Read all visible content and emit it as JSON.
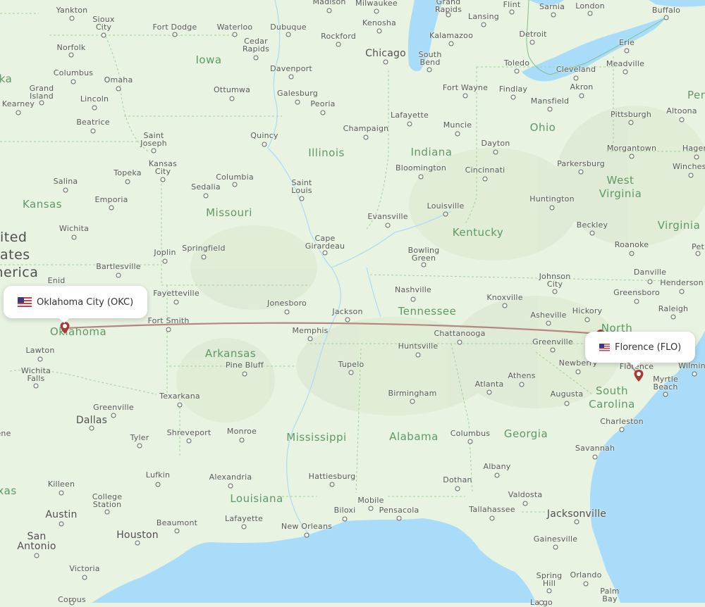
{
  "map": {
    "colors": {
      "land": "#e9f3e2",
      "water": "#a8dcf8",
      "route": "#b07a78",
      "marker": "#a83a3a",
      "state_label": "#5d9a63",
      "city_label": "#5a5a5a"
    },
    "country_label_lines": [
      "ited",
      "ates",
      "merica"
    ],
    "states": [
      {
        "name": "Iowa"
      },
      {
        "name": "Illinois"
      },
      {
        "name": "Indiana"
      },
      {
        "name": "Ohio"
      },
      {
        "name": "Pennsy"
      },
      {
        "name": "West Virginia"
      },
      {
        "name": "Virginia"
      },
      {
        "name": "Kansas"
      },
      {
        "name": "Missouri"
      },
      {
        "name": "Kentucky"
      },
      {
        "name": "Tennessee"
      },
      {
        "name": "North"
      },
      {
        "name": "Oklahoma"
      },
      {
        "name": "Arkansas"
      },
      {
        "name": "Mississippi"
      },
      {
        "name": "Alabama"
      },
      {
        "name": "Georgia"
      },
      {
        "name": "South Carolina"
      },
      {
        "name": "Louisiana"
      },
      {
        "name": "xas"
      },
      {
        "name": "ka"
      }
    ],
    "cities": [
      {
        "name": "Yankton"
      },
      {
        "name": "Sioux City"
      },
      {
        "name": "Fort Dodge"
      },
      {
        "name": "Waterloo"
      },
      {
        "name": "Dubuque"
      },
      {
        "name": "Madison"
      },
      {
        "name": "Milwaukee"
      },
      {
        "name": "Kenosha"
      },
      {
        "name": "Grand Rapids"
      },
      {
        "name": "Lansing"
      },
      {
        "name": "Flint"
      },
      {
        "name": "Sarnia"
      },
      {
        "name": "London"
      },
      {
        "name": "Buffalo"
      },
      {
        "name": "Norfolk"
      },
      {
        "name": "Cedar Rapids"
      },
      {
        "name": "Rockford"
      },
      {
        "name": "Chicago"
      },
      {
        "name": "Kalamazoo"
      },
      {
        "name": "Detroit"
      },
      {
        "name": "Erie"
      },
      {
        "name": "Columbus"
      },
      {
        "name": "Omaha"
      },
      {
        "name": "Davenport"
      },
      {
        "name": "South Bend"
      },
      {
        "name": "Toledo"
      },
      {
        "name": "Cleveland"
      },
      {
        "name": "Meadville"
      },
      {
        "name": "Grand Island"
      },
      {
        "name": "Kearney"
      },
      {
        "name": "Lincoln"
      },
      {
        "name": "Ottumwa"
      },
      {
        "name": "Galesburg"
      },
      {
        "name": "Peoria"
      },
      {
        "name": "Fort Wayne"
      },
      {
        "name": "Findlay"
      },
      {
        "name": "Akron"
      },
      {
        "name": "Mansfield"
      },
      {
        "name": "Pittsburgh"
      },
      {
        "name": "Altoona"
      },
      {
        "name": "Beatrice"
      },
      {
        "name": "Lafayette"
      },
      {
        "name": "Champaign"
      },
      {
        "name": "Muncie"
      },
      {
        "name": "Saint Joseph"
      },
      {
        "name": "Quincy"
      },
      {
        "name": "Dayton"
      },
      {
        "name": "Morgantown"
      },
      {
        "name": "Hagers"
      },
      {
        "name": "Kansas City"
      },
      {
        "name": "Topeka"
      },
      {
        "name": "Bloomington"
      },
      {
        "name": "Cincinnati"
      },
      {
        "name": "Parkersburg"
      },
      {
        "name": "Winchest"
      },
      {
        "name": "Salina"
      },
      {
        "name": "Columbia"
      },
      {
        "name": "Sedalia"
      },
      {
        "name": "Saint Louis"
      },
      {
        "name": "Emporia"
      },
      {
        "name": "Huntington"
      },
      {
        "name": "Louisville"
      },
      {
        "name": "Evansville"
      },
      {
        "name": "Wichita"
      },
      {
        "name": "Beckley"
      },
      {
        "name": "Cape Girardeau"
      },
      {
        "name": "Roanoke"
      },
      {
        "name": "Pet"
      },
      {
        "name": "Bowling Green"
      },
      {
        "name": "Joplin"
      },
      {
        "name": "Springfield"
      },
      {
        "name": "Bartlesville"
      },
      {
        "name": "Danville"
      },
      {
        "name": "Johnson City"
      },
      {
        "name": "Henderson"
      },
      {
        "name": "Enid"
      },
      {
        "name": "Nashville"
      },
      {
        "name": "Fayetteville"
      },
      {
        "name": "Greensboro"
      },
      {
        "name": "Knoxville"
      },
      {
        "name": "Jonesboro"
      },
      {
        "name": "Raleigh"
      },
      {
        "name": "Hickory"
      },
      {
        "name": "Asheville"
      },
      {
        "name": "Jackson"
      },
      {
        "name": "Fort Smith"
      },
      {
        "name": "Memphis"
      },
      {
        "name": "Chattanooga"
      },
      {
        "name": "Greenville"
      },
      {
        "name": "Huntsville"
      },
      {
        "name": "Lawton"
      },
      {
        "name": "Newberry"
      },
      {
        "name": "Florence"
      },
      {
        "name": "Wilming"
      },
      {
        "name": "Myrtle Beach"
      },
      {
        "name": "Pine Bluff"
      },
      {
        "name": "Wichita Falls"
      },
      {
        "name": "Tupelo"
      },
      {
        "name": "Athens"
      },
      {
        "name": "Atlanta"
      },
      {
        "name": "Birmingham"
      },
      {
        "name": "Texarkana"
      },
      {
        "name": "Augusta"
      },
      {
        "name": "Greenville"
      },
      {
        "name": "Dallas"
      },
      {
        "name": "Charleston"
      },
      {
        "name": "Shreveport"
      },
      {
        "name": "Monroe"
      },
      {
        "name": "Tyler"
      },
      {
        "name": "Columbus"
      },
      {
        "name": "Savannah"
      },
      {
        "name": "ene"
      },
      {
        "name": "Albany"
      },
      {
        "name": "Lufkin"
      },
      {
        "name": "Alexandria"
      },
      {
        "name": "Hattiesburg"
      },
      {
        "name": "Killeen"
      },
      {
        "name": "Dothan"
      },
      {
        "name": "College Station"
      },
      {
        "name": "Valdosta"
      },
      {
        "name": "Mobile"
      },
      {
        "name": "Tallahassee"
      },
      {
        "name": "Jacksonville"
      },
      {
        "name": "Austin"
      },
      {
        "name": "Lafayette"
      },
      {
        "name": "Biloxi"
      },
      {
        "name": "Pensacola"
      },
      {
        "name": "Beaumont"
      },
      {
        "name": "New Orleans"
      },
      {
        "name": "Houston"
      },
      {
        "name": "Gainesville"
      },
      {
        "name": "San Antonio"
      },
      {
        "name": "Victoria"
      },
      {
        "name": "Spring Hill"
      },
      {
        "name": "Orlando"
      },
      {
        "name": "Palm Bay"
      },
      {
        "name": "Corpus"
      },
      {
        "name": "Largo"
      }
    ],
    "origin": {
      "label": "Oklahoma City (OKC)",
      "flag": "us-flag-icon"
    },
    "destination": {
      "label": "Florence (FLO)",
      "flag": "us-flag-icon"
    }
  }
}
